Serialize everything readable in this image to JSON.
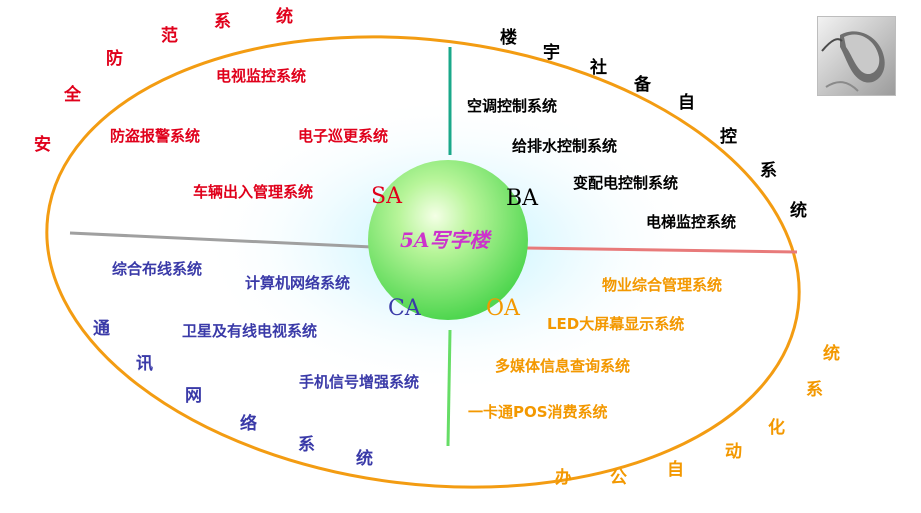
{
  "center": {
    "label": "5A写字楼"
  },
  "quadrant_codes": {
    "sa": "SA",
    "ba": "BA",
    "ca": "CA",
    "oa": "OA"
  },
  "arc_labels": {
    "security": [
      "安",
      "全",
      "防",
      "范",
      "系",
      "统"
    ],
    "building": [
      "楼",
      "宇",
      "社",
      "备",
      "自",
      "控",
      "系",
      "统"
    ],
    "communication": [
      "通",
      "讯",
      "网",
      "络",
      "系",
      "统"
    ],
    "office": [
      "办",
      "公",
      "自",
      "动",
      "化",
      "系",
      "统"
    ]
  },
  "systems": {
    "sa": [
      "电视监控系统",
      "防盗报警系统",
      "电子巡更系统",
      "车辆出入管理系统"
    ],
    "ba": [
      "空调控制系统",
      "给排水控制系统",
      "变配电控制系统",
      "电梯监控系统"
    ],
    "ca": [
      "综合布线系统",
      "计算机网络系统",
      "卫星及有线电视系统",
      "手机信号增强系统"
    ],
    "oa": [
      "物业综合管理系统",
      "LED大屏幕显示系统",
      "多媒体信息查询系统",
      "一卡通POS消费系统"
    ]
  },
  "colors": {
    "ellipse": "#f39c12",
    "sa": "#e0001b",
    "ba": "#000000",
    "ca": "#3a3aa8",
    "oa": "#f39800",
    "divider_top": "#1aa88a",
    "divider_left": "#a0a0a0",
    "divider_right": "#e87a7a",
    "divider_bottom": "#66dd66",
    "center_text": "#cc33cc"
  },
  "decor": {
    "thumbnail": "computer-mouse-image"
  }
}
